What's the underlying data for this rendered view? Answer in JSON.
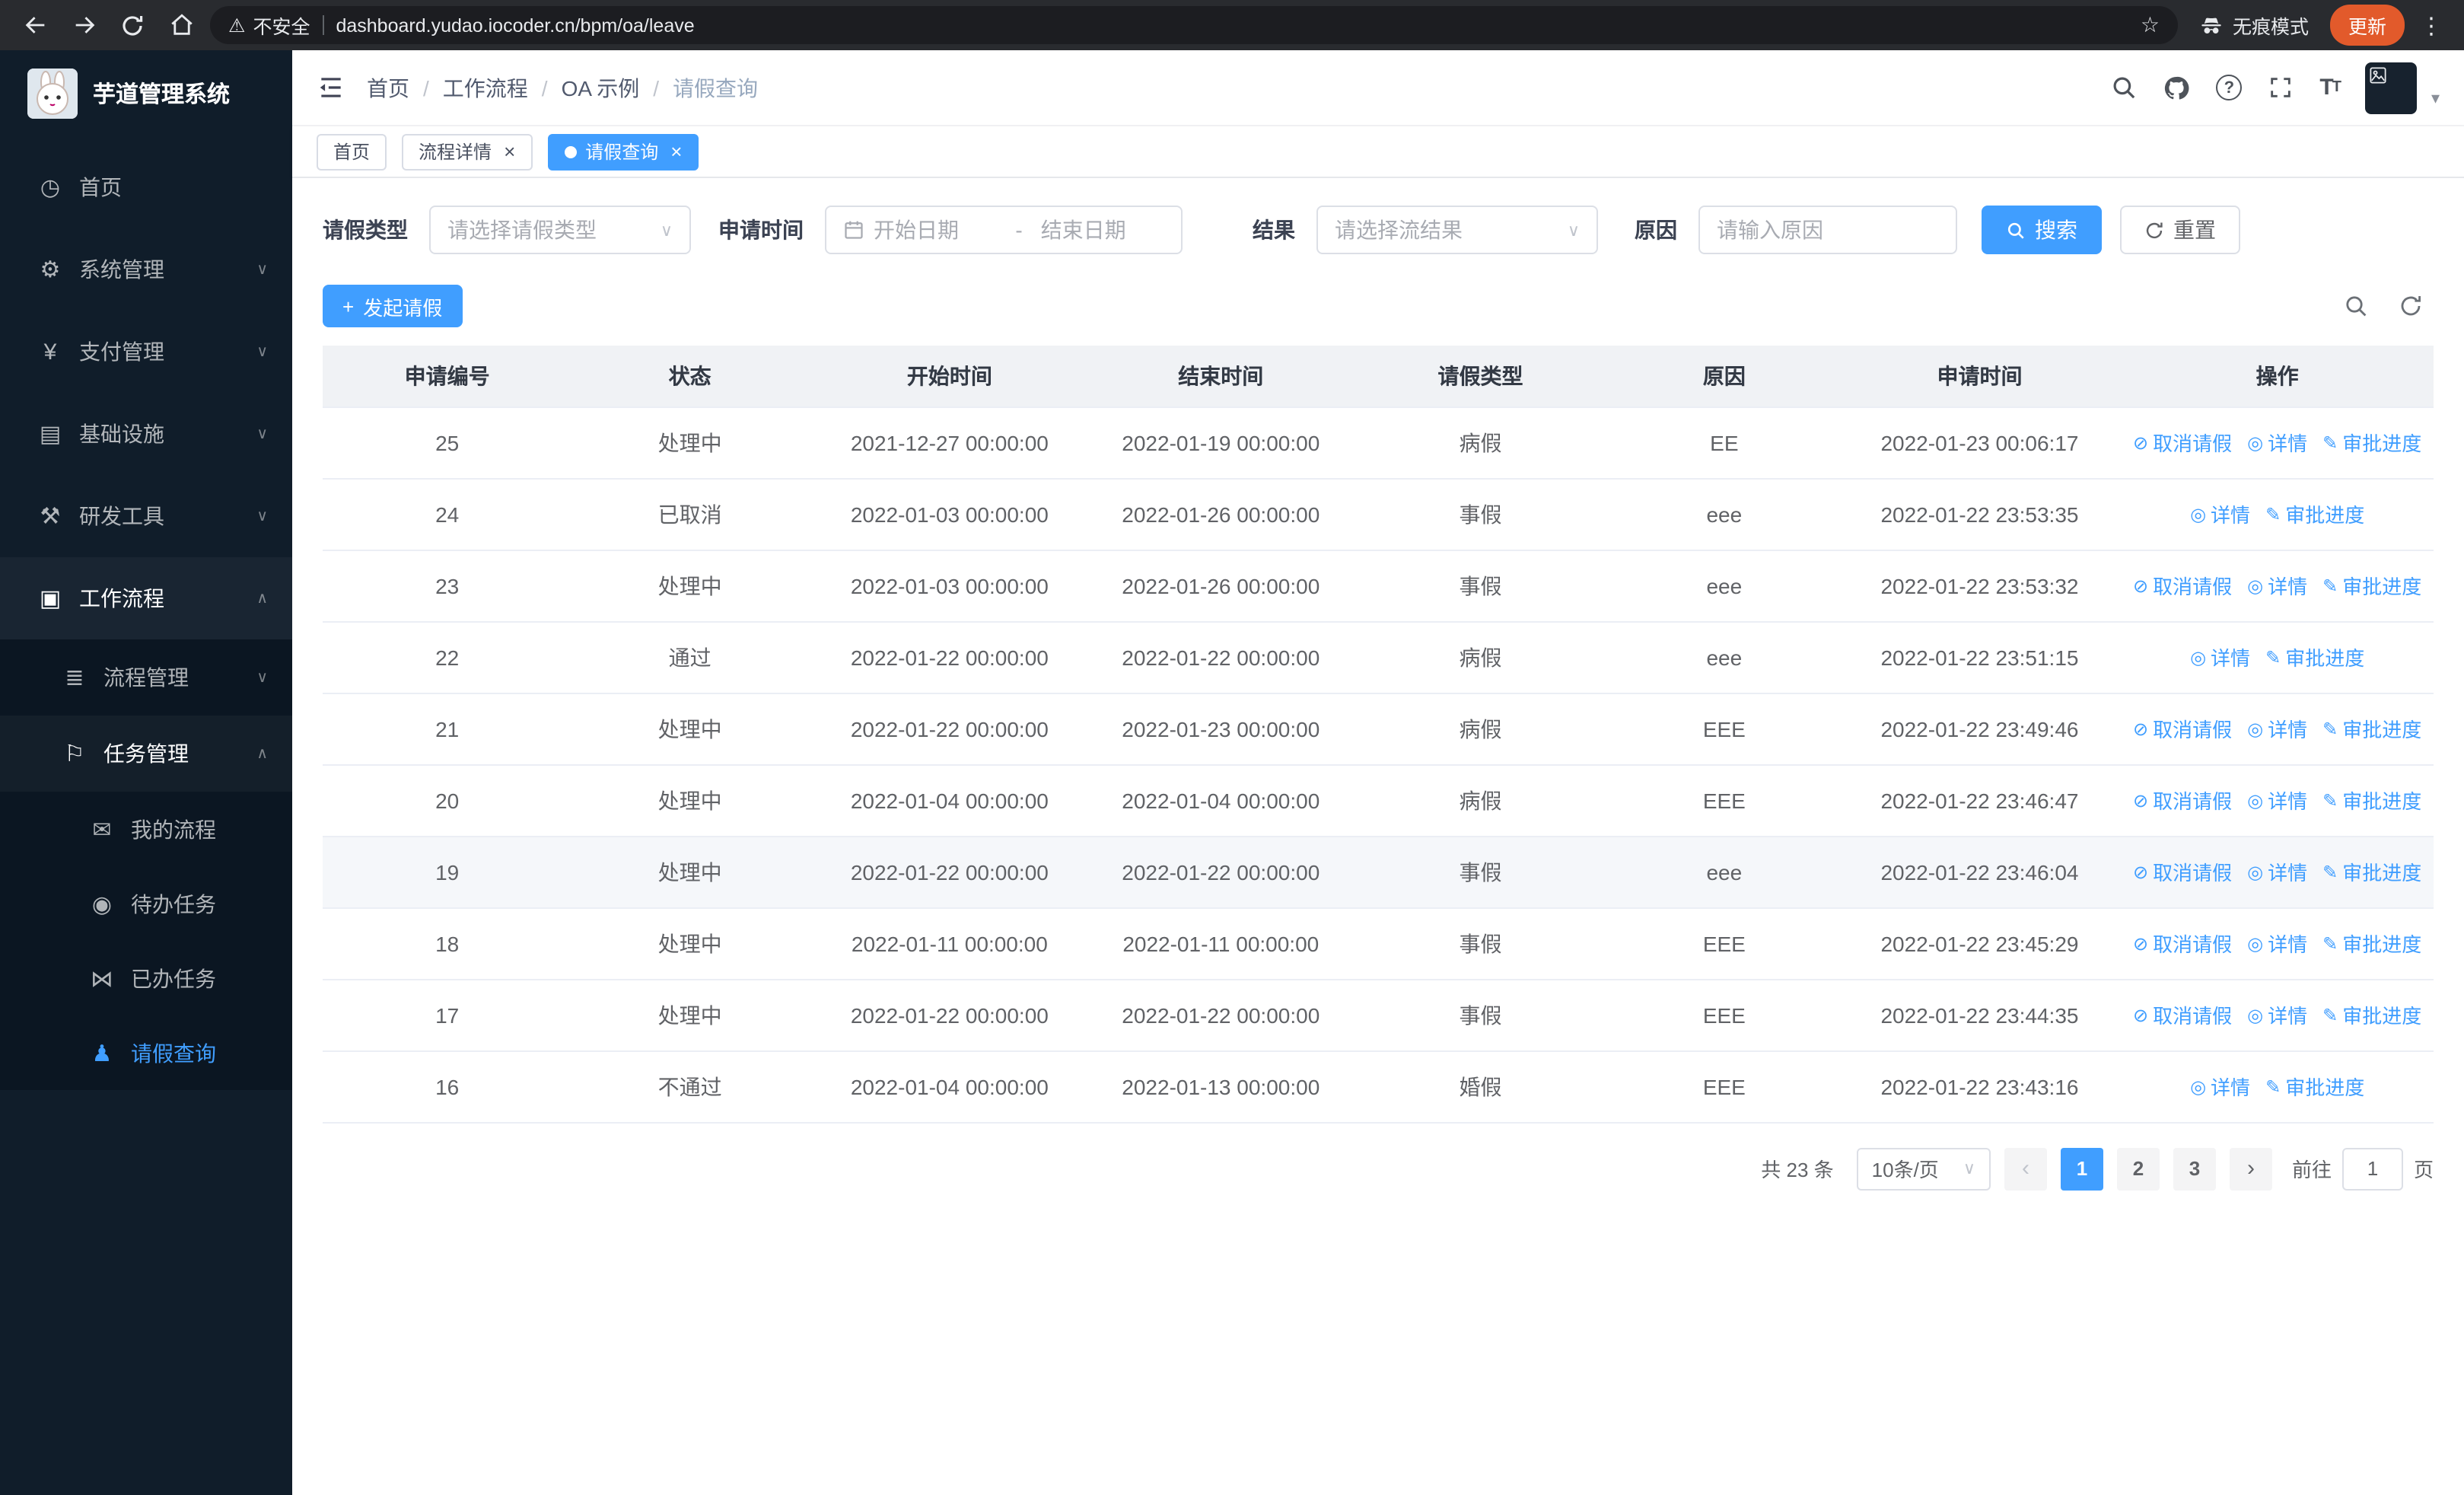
{
  "browser": {
    "security_label": "不安全",
    "url": "dashboard.yudao.iocoder.cn/bpm/oa/leave",
    "incognito_label": "无痕模式",
    "update_label": "更新"
  },
  "sidebar": {
    "logo_title": "芋道管理系统",
    "menu": [
      {
        "name": "home",
        "label": "首页",
        "icon": "dashboard-icon",
        "glyph": "◷",
        "level": 1
      },
      {
        "name": "system-management",
        "label": "系统管理",
        "icon": "gear-icon",
        "glyph": "⚙",
        "level": 1,
        "chevron": "down"
      },
      {
        "name": "payment-management",
        "label": "支付管理",
        "icon": "payment-icon",
        "glyph": "¥",
        "level": 1,
        "chevron": "down"
      },
      {
        "name": "infrastructure",
        "label": "基础设施",
        "icon": "infrastructure-icon",
        "glyph": "▤",
        "level": 1,
        "chevron": "down"
      },
      {
        "name": "dev-tools",
        "label": "研发工具",
        "icon": "tools-icon",
        "glyph": "⚒",
        "level": 1,
        "chevron": "down"
      },
      {
        "name": "workflow",
        "label": "工作流程",
        "icon": "workflow-icon",
        "glyph": "▣",
        "level": 1,
        "chevron": "up",
        "open": true
      },
      {
        "name": "process-management",
        "label": "流程管理",
        "icon": "process-icon",
        "glyph": "≣",
        "level": 2,
        "chevron": "down"
      },
      {
        "name": "task-management",
        "label": "任务管理",
        "icon": "task-icon",
        "glyph": "⚐",
        "level": 2,
        "chevron": "up",
        "open": true
      },
      {
        "name": "my-process",
        "label": "我的流程",
        "icon": "chat-bubble-icon",
        "glyph": "✉",
        "level": 3
      },
      {
        "name": "todo-tasks",
        "label": "待办任务",
        "icon": "eye-icon",
        "glyph": "◉",
        "level": 3
      },
      {
        "name": "done-tasks",
        "label": "已办任务",
        "icon": "done-icon",
        "glyph": "⋈",
        "level": 3
      },
      {
        "name": "leave-query",
        "label": "请假查询",
        "icon": "person-icon",
        "glyph": "♟",
        "level": 3,
        "active": true
      }
    ]
  },
  "header": {
    "breadcrumb": [
      "首页",
      "工作流程",
      "OA 示例",
      "请假查询"
    ]
  },
  "tabs": [
    {
      "label": "首页",
      "closable": false,
      "active": false
    },
    {
      "label": "流程详情",
      "closable": true,
      "active": false
    },
    {
      "label": "请假查询",
      "closable": true,
      "active": true
    }
  ],
  "filters": {
    "leave_type_label": "请假类型",
    "leave_type_placeholder": "请选择请假类型",
    "apply_time_label": "申请时间",
    "start_date_placeholder": "开始日期",
    "date_separator": "-",
    "end_date_placeholder": "结束日期",
    "result_label": "结果",
    "result_placeholder": "请选择流结果",
    "reason_label": "原因",
    "reason_placeholder": "请输入原因",
    "search_button": "搜索",
    "reset_button": "重置"
  },
  "toolbar": {
    "create_button": "发起请假"
  },
  "table": {
    "columns": [
      "申请编号",
      "状态",
      "开始时间",
      "结束时间",
      "请假类型",
      "原因",
      "申请时间",
      "操作"
    ],
    "action_labels": {
      "cancel": "取消请假",
      "detail": "详情",
      "progress": "审批进度"
    },
    "rows": [
      {
        "id": "25",
        "status": "处理中",
        "start": "2021-12-27 00:00:00",
        "end": "2022-01-19 00:00:00",
        "type": "病假",
        "reason": "EE",
        "applied": "2022-01-23 00:06:17",
        "actions": [
          "cancel",
          "detail",
          "progress"
        ]
      },
      {
        "id": "24",
        "status": "已取消",
        "start": "2022-01-03 00:00:00",
        "end": "2022-01-26 00:00:00",
        "type": "事假",
        "reason": "eee",
        "applied": "2022-01-22 23:53:35",
        "actions": [
          "detail",
          "progress"
        ]
      },
      {
        "id": "23",
        "status": "处理中",
        "start": "2022-01-03 00:00:00",
        "end": "2022-01-26 00:00:00",
        "type": "事假",
        "reason": "eee",
        "applied": "2022-01-22 23:53:32",
        "actions": [
          "cancel",
          "detail",
          "progress"
        ]
      },
      {
        "id": "22",
        "status": "通过",
        "start": "2022-01-22 00:00:00",
        "end": "2022-01-22 00:00:00",
        "type": "病假",
        "reason": "eee",
        "applied": "2022-01-22 23:51:15",
        "actions": [
          "detail",
          "progress"
        ]
      },
      {
        "id": "21",
        "status": "处理中",
        "start": "2022-01-22 00:00:00",
        "end": "2022-01-23 00:00:00",
        "type": "病假",
        "reason": "EEE",
        "applied": "2022-01-22 23:49:46",
        "actions": [
          "cancel",
          "detail",
          "progress"
        ]
      },
      {
        "id": "20",
        "status": "处理中",
        "start": "2022-01-04 00:00:00",
        "end": "2022-01-04 00:00:00",
        "type": "病假",
        "reason": "EEE",
        "applied": "2022-01-22 23:46:47",
        "actions": [
          "cancel",
          "detail",
          "progress"
        ]
      },
      {
        "id": "19",
        "status": "处理中",
        "start": "2022-01-22 00:00:00",
        "end": "2022-01-22 00:00:00",
        "type": "事假",
        "reason": "eee",
        "applied": "2022-01-22 23:46:04",
        "actions": [
          "cancel",
          "detail",
          "progress"
        ],
        "hover": true
      },
      {
        "id": "18",
        "status": "处理中",
        "start": "2022-01-11 00:00:00",
        "end": "2022-01-11 00:00:00",
        "type": "事假",
        "reason": "EEE",
        "applied": "2022-01-22 23:45:29",
        "actions": [
          "cancel",
          "detail",
          "progress"
        ]
      },
      {
        "id": "17",
        "status": "处理中",
        "start": "2022-01-22 00:00:00",
        "end": "2022-01-22 00:00:00",
        "type": "事假",
        "reason": "EEE",
        "applied": "2022-01-22 23:44:35",
        "actions": [
          "cancel",
          "detail",
          "progress"
        ]
      },
      {
        "id": "16",
        "status": "不通过",
        "start": "2022-01-04 00:00:00",
        "end": "2022-01-13 00:00:00",
        "type": "婚假",
        "reason": "EEE",
        "applied": "2022-01-22 23:43:16",
        "actions": [
          "detail",
          "progress"
        ]
      }
    ]
  },
  "pagination": {
    "total_label": "共 23 条",
    "page_size": "10条/页",
    "pages": [
      "1",
      "2",
      "3"
    ],
    "active_page": "1",
    "prev_glyph": "‹",
    "next_glyph": "›",
    "goto_label": "前往",
    "goto_value": "1",
    "goto_suffix": "页"
  },
  "colors": {
    "accent": "#409eff",
    "sidebar_bg": "#101d2a",
    "chrome_bg": "#292b2f"
  }
}
